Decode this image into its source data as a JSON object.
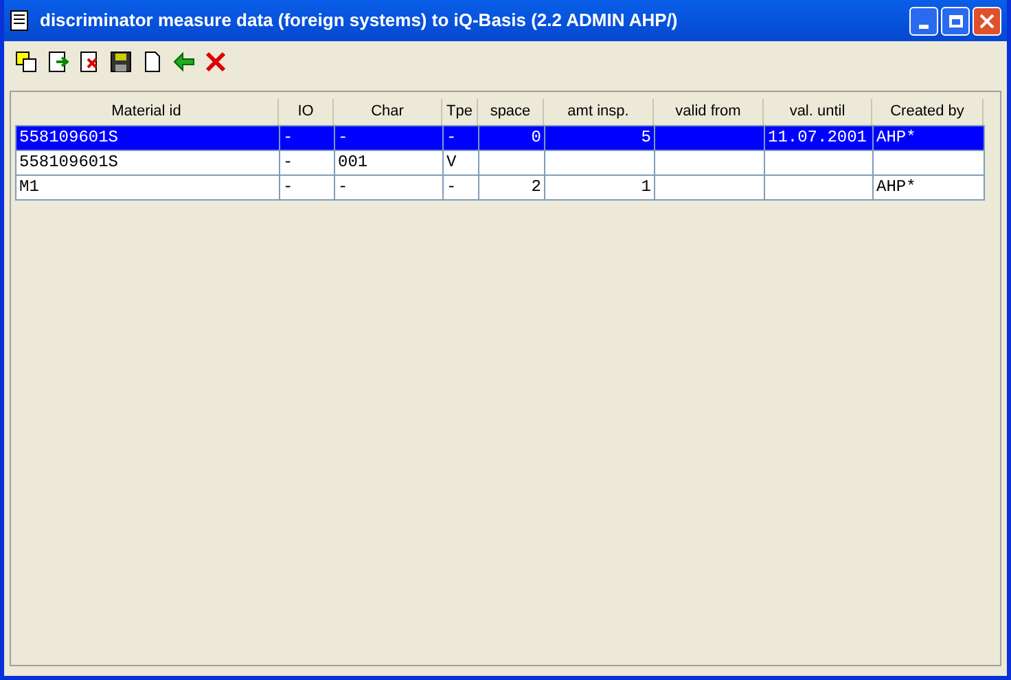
{
  "window": {
    "title": "discriminator measure data (foreign systems) to iQ-Basis (2.2 ADMIN AHP/)"
  },
  "table": {
    "columns": [
      {
        "label": "Material id",
        "kind": "text"
      },
      {
        "label": "IO",
        "kind": "text"
      },
      {
        "label": "Char",
        "kind": "text"
      },
      {
        "label": "Tpe",
        "kind": "text"
      },
      {
        "label": "space",
        "kind": "number"
      },
      {
        "label": "amt insp.",
        "kind": "number"
      },
      {
        "label": "valid from",
        "kind": "text"
      },
      {
        "label": "val. until",
        "kind": "text"
      },
      {
        "label": "Created by",
        "kind": "text"
      }
    ],
    "rows": [
      {
        "selected": true,
        "cells": [
          "558109601S",
          "-",
          "-",
          "-",
          "0",
          "5",
          "",
          "11.07.2001",
          "AHP*"
        ]
      },
      {
        "selected": false,
        "cells": [
          "558109601S",
          "-",
          "001",
          "V",
          "",
          "",
          "",
          "",
          ""
        ]
      },
      {
        "selected": false,
        "cells": [
          "M1",
          "-",
          "-",
          "-",
          "2",
          "1",
          "",
          "",
          "AHP*"
        ]
      }
    ]
  }
}
